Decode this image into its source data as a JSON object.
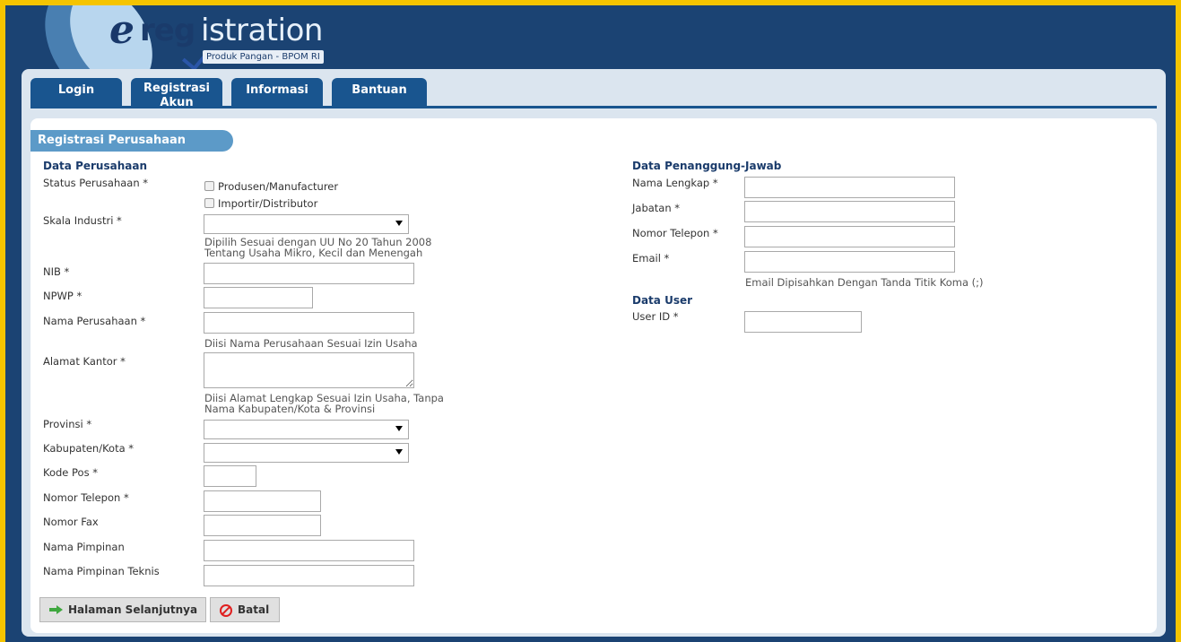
{
  "logo": {
    "e": "e",
    "reg": "reg",
    "istration": "istration",
    "subtitle": "Produk Pangan - BPOM RI"
  },
  "tabs": [
    {
      "label": "Login"
    },
    {
      "label": "Registrasi Akun"
    },
    {
      "label": "Informasi"
    },
    {
      "label": "Bantuan"
    }
  ],
  "section_title": "Registrasi Perusahaan",
  "left": {
    "heading": "Data Perusahaan",
    "status_label": "Status Perusahaan *",
    "status_options": [
      "Produsen/Manufacturer",
      "Importir/Distributor"
    ],
    "skala_label": "Skala Industri *",
    "skala_value": "",
    "skala_hint1": "Dipilih Sesuai dengan UU No 20 Tahun 2008",
    "skala_hint2": "Tentang Usaha Mikro, Kecil dan Menengah",
    "nib_label": "NIB *",
    "npwp_label": "NPWP *",
    "nama_label": "Nama Perusahaan *",
    "nama_hint": "Diisi Nama Perusahaan Sesuai Izin Usaha",
    "alamat_label": "Alamat Kantor *",
    "alamat_hint1": "Diisi Alamat Lengkap Sesuai Izin Usaha, Tanpa",
    "alamat_hint2": "Nama Kabupaten/Kota & Provinsi",
    "provinsi_label": "Provinsi *",
    "provinsi_value": "",
    "kabupaten_label": "Kabupaten/Kota *",
    "kabupaten_value": "",
    "kodepos_label": "Kode Pos *",
    "telepon_label": "Nomor Telepon *",
    "fax_label": "Nomor Fax",
    "pimpinan_label": "Nama Pimpinan",
    "pimpinan_teknis_label": "Nama Pimpinan Teknis"
  },
  "right": {
    "heading": "Data Penanggung-Jawab",
    "nama_label": "Nama Lengkap *",
    "jabatan_label": "Jabatan *",
    "telepon_label": "Nomor Telepon *",
    "email_label": "Email *",
    "email_hint": "Email Dipisahkan Dengan Tanda Titik Koma (;)",
    "user_heading": "Data User",
    "userid_label": "User ID *"
  },
  "buttons": {
    "next": "Halaman Selanjutnya",
    "cancel": "Batal"
  },
  "colors": {
    "page_border": "#f5c400",
    "header_bg": "#1b4373",
    "tab_bg": "#19558f",
    "section_tab_bg": "#5c9ac8"
  }
}
